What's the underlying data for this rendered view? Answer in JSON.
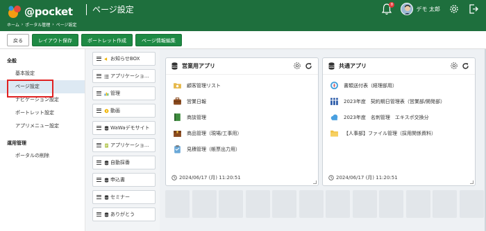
{
  "header": {
    "logo_text": "@pocket",
    "page_title": "ページ設定",
    "breadcrumb": [
      "ホーム",
      "ポータル管理",
      "ページ設定"
    ],
    "notification_count": "8",
    "user_name": "デモ 太郎"
  },
  "toolbar": {
    "back_label": "戻る",
    "save_layout_label": "レイアウト保存",
    "create_portlet_label": "ポートレット作成",
    "edit_page_info_label": "ページ情報編集"
  },
  "sidebar": {
    "section_general": "全般",
    "general_items": [
      "基本設定",
      "ページ設定",
      "ナビゲーション設定",
      "ポートレット設定",
      "アプリメニュー設定"
    ],
    "section_ops": "運用管理",
    "ops_items": [
      "ポータルの削除"
    ],
    "active_item": "ページ設定"
  },
  "parts": [
    {
      "label": "お知らせBOX",
      "icon": "megaphone-icon",
      "color": "#f0b400"
    },
    {
      "label": "アプリケーショ...",
      "icon": "list-icon",
      "color": "#555555"
    },
    {
      "label": "管理",
      "icon": "chart-icon",
      "color": "#3a8fd8"
    },
    {
      "label": "動画",
      "icon": "video-icon",
      "color": "#f0b400"
    },
    {
      "label": "WaWaデモサイト",
      "icon": "db-icon",
      "color": "#333333"
    },
    {
      "label": "アプリケーショ...",
      "icon": "doc-icon",
      "color": "#b0c44a"
    },
    {
      "label": "自動採番",
      "icon": "db-icon",
      "color": "#333333"
    },
    {
      "label": "申込書",
      "icon": "db-icon",
      "color": "#333333"
    },
    {
      "label": "セミナー",
      "icon": "db-icon",
      "color": "#333333"
    },
    {
      "label": "ありがとう",
      "icon": "db-icon",
      "color": "#333333"
    }
  ],
  "portlets": [
    {
      "title": "営業用アプリ",
      "items": [
        {
          "label": "顧客管理リスト",
          "icon": "folder-hands-icon",
          "color": "#e6b84a"
        },
        {
          "label": "営業日報",
          "icon": "briefcase-icon",
          "color": "#8a4a1e"
        },
        {
          "label": "商談管理",
          "icon": "book-icon",
          "color": "#3d8b3d"
        },
        {
          "label": "商品管理（現場/工事用）",
          "icon": "box-icon",
          "color": "#8a4a1e"
        },
        {
          "label": "見積管理（帳票出力用）",
          "icon": "clipboard-icon",
          "color": "#6aa8d8"
        }
      ],
      "timestamp": "2024/06/17 (月) 11:20:51"
    },
    {
      "title": "共通アプリ",
      "items": [
        {
          "label": "書類送付表（経理部用）",
          "icon": "compass-icon",
          "color": "#3a9bd8"
        },
        {
          "label": "2023年度　契約期日管理表（営業部/開発部）",
          "icon": "binders-icon",
          "color": "#2a5aa8"
        },
        {
          "label": "2023年度　名刺管理　エキスポ交換分",
          "icon": "cloud-icon",
          "color": "#4aa0e0"
        },
        {
          "label": "【人事部】ファイル管理（採用関係資料）",
          "icon": "folder-icon",
          "color": "#f0c040"
        }
      ],
      "timestamp": "2024/06/17 (月) 11:20:51"
    }
  ]
}
